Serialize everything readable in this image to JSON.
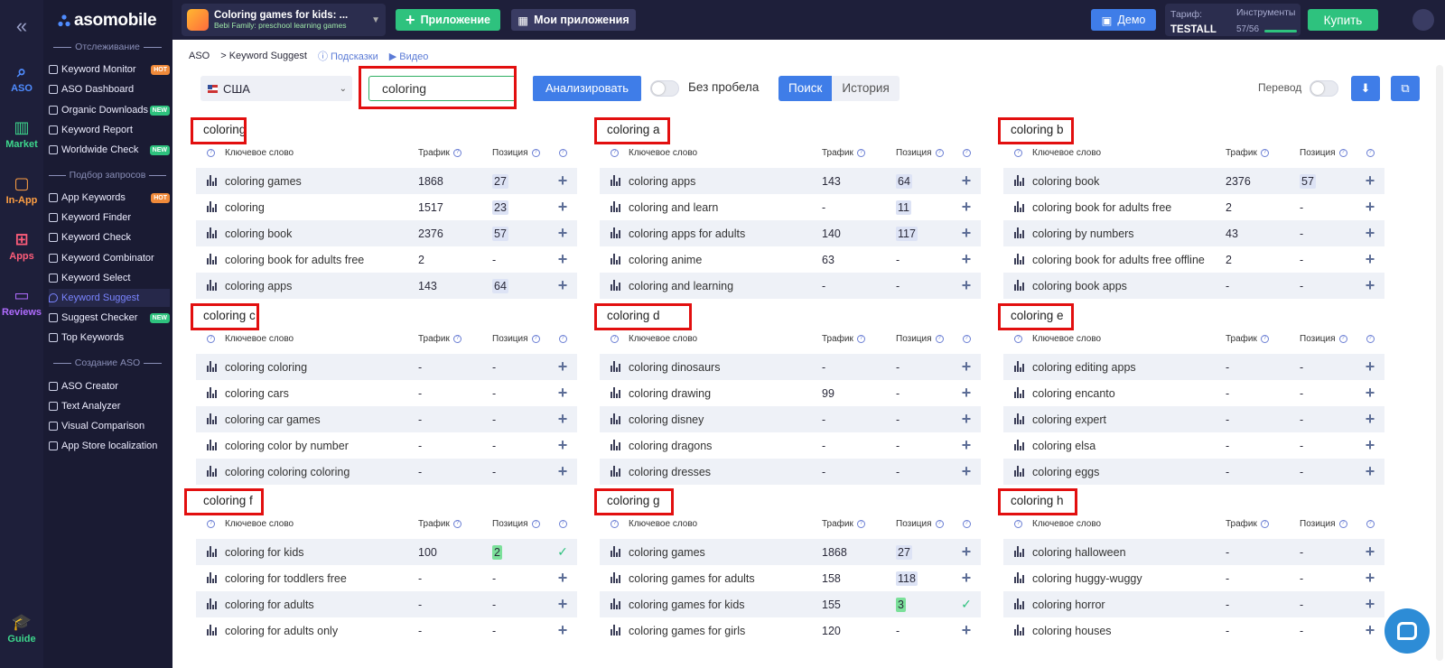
{
  "rail": {
    "items": [
      {
        "label": "ASO",
        "icon": "search-icon",
        "color": "#4f8cff"
      },
      {
        "label": "Market",
        "icon": "chart-icon",
        "color": "#3dd68c"
      },
      {
        "label": "In-App",
        "icon": "bag-icon",
        "color": "#ff9f43"
      },
      {
        "label": "Apps",
        "icon": "grid-icon",
        "color": "#ff5d7a"
      },
      {
        "label": "Reviews",
        "icon": "chat-icon",
        "color": "#b06cff"
      }
    ],
    "guide": "Guide"
  },
  "brand": "asomobile",
  "sidebar": {
    "sections": [
      "Отслеживание",
      "Подбор запросов",
      "Создание ASO"
    ],
    "items": [
      {
        "label": "Keyword Monitor",
        "badge": "HOT"
      },
      {
        "label": "ASO Dashboard",
        "badge": ""
      },
      {
        "label": "Organic Downloads",
        "badge": "NEW"
      },
      {
        "label": "Keyword Report",
        "badge": ""
      },
      {
        "label": "Worldwide Check",
        "badge": "NEW"
      },
      {
        "label": "App Keywords",
        "badge": "HOT"
      },
      {
        "label": "Keyword Finder",
        "badge": ""
      },
      {
        "label": "Keyword Check",
        "badge": ""
      },
      {
        "label": "Keyword Combinator",
        "badge": ""
      },
      {
        "label": "Keyword Select",
        "badge": ""
      },
      {
        "label": "Keyword Suggest",
        "badge": ""
      },
      {
        "label": "Suggest Checker",
        "badge": "NEW"
      },
      {
        "label": "Top Keywords",
        "badge": ""
      },
      {
        "label": "ASO Creator",
        "badge": ""
      },
      {
        "label": "Text Analyzer",
        "badge": ""
      },
      {
        "label": "Visual Comparison",
        "badge": ""
      },
      {
        "label": "App Store localization",
        "badge": ""
      }
    ]
  },
  "topbar": {
    "app_title": "Coloring games for kids: ...",
    "app_sub": "Bebi Family: preschool learning games",
    "add_app": "Приложение",
    "my_apps": "Мои приложения",
    "demo": "Демо",
    "tarif_label": "Тариф:",
    "tarif_value": "TESTALL",
    "tools_label": "Инструменты",
    "tools_value": "57/56",
    "buy": "Купить"
  },
  "breadcrumb": {
    "root": "ASO",
    "page": "> Keyword Suggest",
    "hints": "Подсказки",
    "video": "Видео"
  },
  "controls": {
    "country": "США",
    "search_value": "coloring",
    "analyze": "Анализировать",
    "no_space": "Без пробела",
    "tab_search": "Поиск",
    "tab_history": "История",
    "translate": "Перевод"
  },
  "table_header": {
    "keyword": "Ключевое слово",
    "traffic": "Трафик",
    "position": "Позиция"
  },
  "cards": [
    {
      "title": "coloring",
      "rows": [
        {
          "keyword": "coloring games",
          "traffic": "1868",
          "position": "27",
          "action": "add"
        },
        {
          "keyword": "coloring",
          "traffic": "1517",
          "position": "23",
          "action": "add"
        },
        {
          "keyword": "coloring book",
          "traffic": "2376",
          "position": "57",
          "action": "add"
        },
        {
          "keyword": "coloring book for adults free",
          "traffic": "2",
          "position": "-",
          "action": "add"
        },
        {
          "keyword": "coloring apps",
          "traffic": "143",
          "position": "64",
          "action": "add"
        }
      ]
    },
    {
      "title": "coloring a",
      "rows": [
        {
          "keyword": "coloring apps",
          "traffic": "143",
          "position": "64",
          "action": "add"
        },
        {
          "keyword": "coloring and learn",
          "traffic": "-",
          "position": "11",
          "action": "add"
        },
        {
          "keyword": "coloring apps for adults",
          "traffic": "140",
          "position": "117",
          "action": "add"
        },
        {
          "keyword": "coloring anime",
          "traffic": "63",
          "position": "-",
          "action": "add"
        },
        {
          "keyword": "coloring and learning",
          "traffic": "-",
          "position": "-",
          "action": "add"
        }
      ]
    },
    {
      "title": "coloring b",
      "rows": [
        {
          "keyword": "coloring book",
          "traffic": "2376",
          "position": "57",
          "action": "add"
        },
        {
          "keyword": "coloring book for adults free",
          "traffic": "2",
          "position": "-",
          "action": "add"
        },
        {
          "keyword": "coloring by numbers",
          "traffic": "43",
          "position": "-",
          "action": "add"
        },
        {
          "keyword": "coloring book for adults free offline",
          "traffic": "2",
          "position": "-",
          "action": "add"
        },
        {
          "keyword": "coloring book apps",
          "traffic": "-",
          "position": "-",
          "action": "add"
        }
      ]
    },
    {
      "title": "coloring c",
      "rows": [
        {
          "keyword": "coloring coloring",
          "traffic": "-",
          "position": "-",
          "action": "add"
        },
        {
          "keyword": "coloring cars",
          "traffic": "-",
          "position": "-",
          "action": "add"
        },
        {
          "keyword": "coloring car games",
          "traffic": "-",
          "position": "-",
          "action": "add"
        },
        {
          "keyword": "coloring color by number",
          "traffic": "-",
          "position": "-",
          "action": "add"
        },
        {
          "keyword": "coloring coloring coloring",
          "traffic": "-",
          "position": "-",
          "action": "add"
        }
      ]
    },
    {
      "title": "coloring d",
      "rows": [
        {
          "keyword": "coloring dinosaurs",
          "traffic": "-",
          "position": "-",
          "action": "add"
        },
        {
          "keyword": "coloring drawing",
          "traffic": "99",
          "position": "-",
          "action": "add"
        },
        {
          "keyword": "coloring disney",
          "traffic": "-",
          "position": "-",
          "action": "add"
        },
        {
          "keyword": "coloring dragons",
          "traffic": "-",
          "position": "-",
          "action": "add"
        },
        {
          "keyword": "coloring dresses",
          "traffic": "-",
          "position": "-",
          "action": "add"
        }
      ]
    },
    {
      "title": "coloring e",
      "rows": [
        {
          "keyword": "coloring editing apps",
          "traffic": "-",
          "position": "-",
          "action": "add"
        },
        {
          "keyword": "coloring encanto",
          "traffic": "-",
          "position": "-",
          "action": "add"
        },
        {
          "keyword": "coloring expert",
          "traffic": "-",
          "position": "-",
          "action": "add"
        },
        {
          "keyword": "coloring elsa",
          "traffic": "-",
          "position": "-",
          "action": "add"
        },
        {
          "keyword": "coloring eggs",
          "traffic": "-",
          "position": "-",
          "action": "add"
        }
      ]
    },
    {
      "title": "coloring f",
      "rows": [
        {
          "keyword": "coloring for kids",
          "traffic": "100",
          "position": "2",
          "action": "check"
        },
        {
          "keyword": "coloring for toddlers free",
          "traffic": "-",
          "position": "-",
          "action": "add"
        },
        {
          "keyword": "coloring for adults",
          "traffic": "-",
          "position": "-",
          "action": "add"
        },
        {
          "keyword": "coloring for adults only",
          "traffic": "-",
          "position": "-",
          "action": "add"
        }
      ]
    },
    {
      "title": "coloring g",
      "rows": [
        {
          "keyword": "coloring games",
          "traffic": "1868",
          "position": "27",
          "action": "add"
        },
        {
          "keyword": "coloring games for adults",
          "traffic": "158",
          "position": "118",
          "action": "add"
        },
        {
          "keyword": "coloring games for kids",
          "traffic": "155",
          "position": "3",
          "action": "check"
        },
        {
          "keyword": "coloring games for girls",
          "traffic": "120",
          "position": "-",
          "action": "add"
        }
      ]
    },
    {
      "title": "coloring h",
      "rows": [
        {
          "keyword": "coloring halloween",
          "traffic": "-",
          "position": "-",
          "action": "add"
        },
        {
          "keyword": "coloring huggy-wuggy",
          "traffic": "-",
          "position": "-",
          "action": "add"
        },
        {
          "keyword": "coloring horror",
          "traffic": "-",
          "position": "-",
          "action": "add"
        },
        {
          "keyword": "coloring houses",
          "traffic": "-",
          "position": "-",
          "action": "add"
        }
      ]
    }
  ]
}
